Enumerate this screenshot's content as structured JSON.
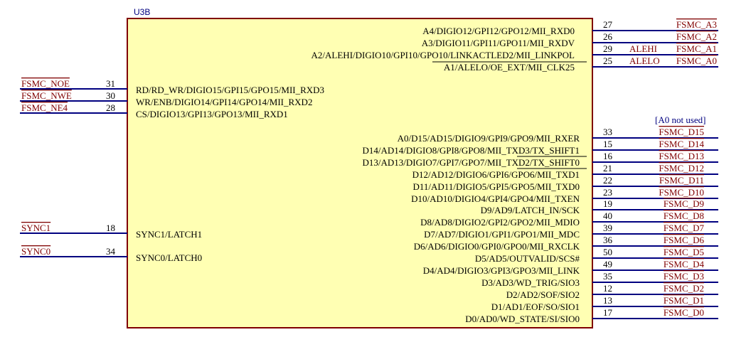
{
  "component": {
    "ref": "U3B",
    "body_fill": "#ffffb3",
    "outline_color": "#800000",
    "wire_color": "#000080",
    "net_color": "#800000",
    "pin_text_color": "#000000",
    "ref_color": "#000080",
    "annotation_color": "#000080"
  },
  "left_pins": [
    {
      "name": "RD/RD_WR/DIGIO15/GPI15/GPO15/MII_RXD3",
      "number": "31",
      "net": "FSMC_NOE"
    },
    {
      "name": "WR/ENB/DIGIO14/GPI14/GPO14/MII_RXD2",
      "number": "30",
      "net": "FSMC_NWE"
    },
    {
      "name": "CS/DIGIO13/GPI13/GPO13/MII_RXD1",
      "number": "28",
      "net": "FSMC_NE4"
    },
    {
      "name": "SYNC1/LATCH1",
      "number": "18",
      "net": "SYNC1"
    },
    {
      "name": "SYNC0/LATCH0",
      "number": "34",
      "net": "SYNC0"
    }
  ],
  "right_pins_top": [
    {
      "name": "A4/DIGIO12/GPI12/GPO12/MII_RXD0",
      "number": "27",
      "net": "FSMC_A3",
      "label": ""
    },
    {
      "name": "A3/DIGIO11/GPI11/GPO11/MII_RXDV",
      "number": "26",
      "net": "FSMC_A2",
      "label": ""
    },
    {
      "name": "A2/ALEHI/DIGIO10/GPI10/GPO10/LINKACTLED2/MII_LINKPOL",
      "number": "29",
      "net": "FSMC_A1",
      "label": "ALEHI"
    },
    {
      "name": "A1/ALELO/OE_EXT/MII_CLK25",
      "number": "25",
      "net": "FSMC_A0",
      "label": "ALELO"
    }
  ],
  "annotation": "[A0 not used]",
  "right_pins_bottom": [
    {
      "name": "A0/D15/AD15/DIGIO9/GPI9/GPO9/MII_RXER",
      "number": "33",
      "net": "FSMC_D15"
    },
    {
      "name": "D14/AD14/DIGIO8/GPI8/GPO8/MII_TXD3/TX_SHIFT1",
      "number": "15",
      "net": "FSMC_D14"
    },
    {
      "name": "D13/AD13/DIGIO7/GPI7/GPO7/MII_TXD2/TX_SHIFT0",
      "number": "16",
      "net": "FSMC_D13"
    },
    {
      "name": "D12/AD12/DIGIO6/GPI6/GPO6/MII_TXD1",
      "number": "21",
      "net": "FSMC_D12"
    },
    {
      "name": "D11/AD11/DIGIO5/GPI5/GPO5/MII_TXD0",
      "number": "22",
      "net": "FSMC_D11"
    },
    {
      "name": "D10/AD10/DIGIO4/GPI4/GPO4/MII_TXEN",
      "number": "23",
      "net": "FSMC_D10"
    },
    {
      "name": "D9/AD9/LATCH_IN/SCK",
      "number": "19",
      "net": "FSMC_D9"
    },
    {
      "name": "D8/AD8/DIGIO2/GPI2/GPO2/MII_MDIO",
      "number": "40",
      "net": "FSMC_D8"
    },
    {
      "name": "D7/AD7/DIGIO1/GPI1/GPO1/MII_MDC",
      "number": "39",
      "net": "FSMC_D7"
    },
    {
      "name": "D6/AD6/DIGIO0/GPI0/GPO0/MII_RXCLK",
      "number": "36",
      "net": "FSMC_D6"
    },
    {
      "name": "D5/AD5/OUTVALID/SCS#",
      "number": "50",
      "net": "FSMC_D5"
    },
    {
      "name": "D4/AD4/DIGIO3/GPI3/GPO3/MII_LINK",
      "number": "49",
      "net": "FSMC_D4"
    },
    {
      "name": "D3/AD3/WD_TRIG/SIO3",
      "number": "35",
      "net": "FSMC_D3"
    },
    {
      "name": "D2/AD2/SOF/SIO2",
      "number": "12",
      "net": "FSMC_D2"
    },
    {
      "name": "D1/AD1/EOF/SO/SIO1",
      "number": "13",
      "net": "FSMC_D1"
    },
    {
      "name": "D0/AD0/WD_STATE/SI/SIO0",
      "number": "17",
      "net": "FSMC_D0"
    }
  ]
}
